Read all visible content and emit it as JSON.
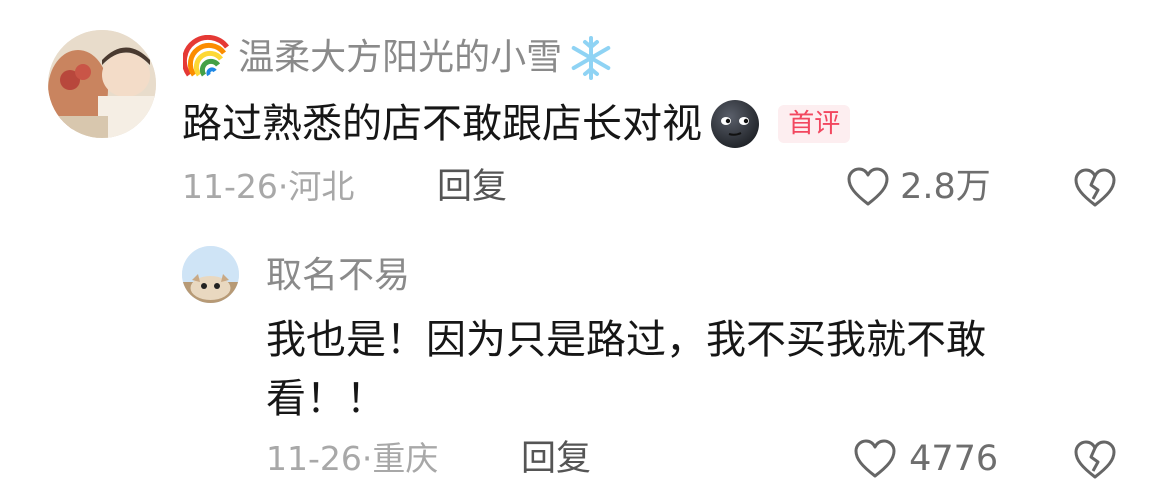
{
  "comments": [
    {
      "username": "温柔大方阳光的小雪",
      "text": "路过熟悉的店不敢跟店长对视",
      "badge": "首评",
      "date": "11-26·",
      "location": "河北",
      "reply_label": "回复",
      "like_count": "2.8万"
    },
    {
      "username": "取名不易",
      "text_line1": "我也是！因为只是路过，我不买我就不敢",
      "text_line2": "看！！",
      "date": "11-26·",
      "location": "重庆",
      "reply_label": "回复",
      "like_count": "4776"
    }
  ],
  "icons": [
    "rainbow-icon",
    "snowflake-icon",
    "new-moon-face-icon",
    "heart-icon",
    "broken-heart-icon"
  ]
}
